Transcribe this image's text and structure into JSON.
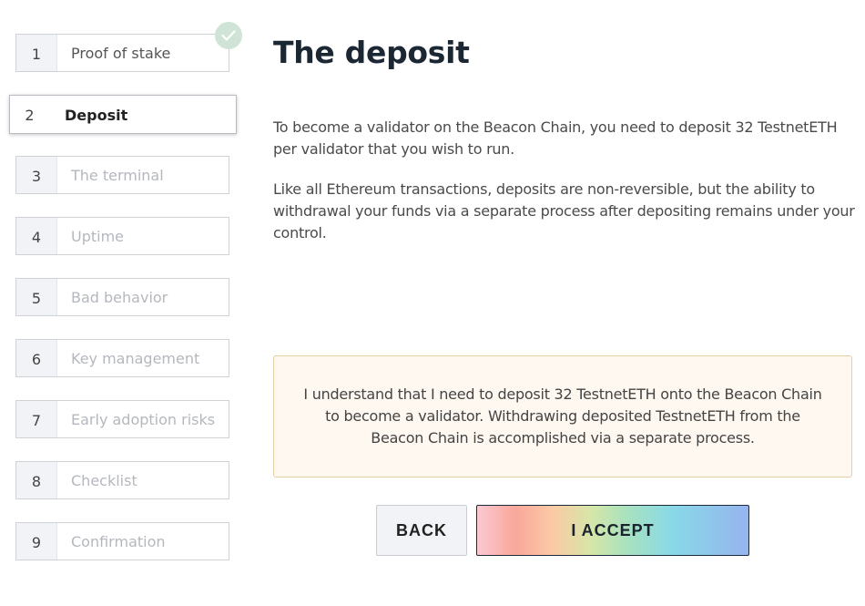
{
  "steps": [
    {
      "num": "1",
      "label": "Proof of stake",
      "state": "done"
    },
    {
      "num": "2",
      "label": "Deposit",
      "state": "active"
    },
    {
      "num": "3",
      "label": "The terminal",
      "state": "pending"
    },
    {
      "num": "4",
      "label": "Uptime",
      "state": "pending"
    },
    {
      "num": "5",
      "label": "Bad behavior",
      "state": "pending"
    },
    {
      "num": "6",
      "label": "Key management",
      "state": "pending"
    },
    {
      "num": "7",
      "label": "Early adoption risks",
      "state": "pending"
    },
    {
      "num": "8",
      "label": "Checklist",
      "state": "pending"
    },
    {
      "num": "9",
      "label": "Confirmation",
      "state": "pending"
    }
  ],
  "completed_icon": "check-circle-icon",
  "main": {
    "title": "The deposit",
    "para1": "To become a validator on the Beacon Chain, you need to deposit 32 TestnetETH per validator that you wish to run.",
    "para2": "Like all Ethereum transactions, deposits are non-reversible, but the ability to withdrawal your funds via a separate process after depositing remains under your control.",
    "notice": "I understand that I need to deposit 32 TestnetETH onto the Beacon Chain to become a validator. Withdrawing deposited TestnetETH from the Beacon Chain is accomplished via a separate process."
  },
  "buttons": {
    "back": "BACK",
    "accept": "I ACCEPT"
  },
  "colors": {
    "title": "#1b2733",
    "notice_bg": "#fff8f0",
    "notice_border": "#e6cfa8",
    "check_bg": "#cfe4d6"
  }
}
